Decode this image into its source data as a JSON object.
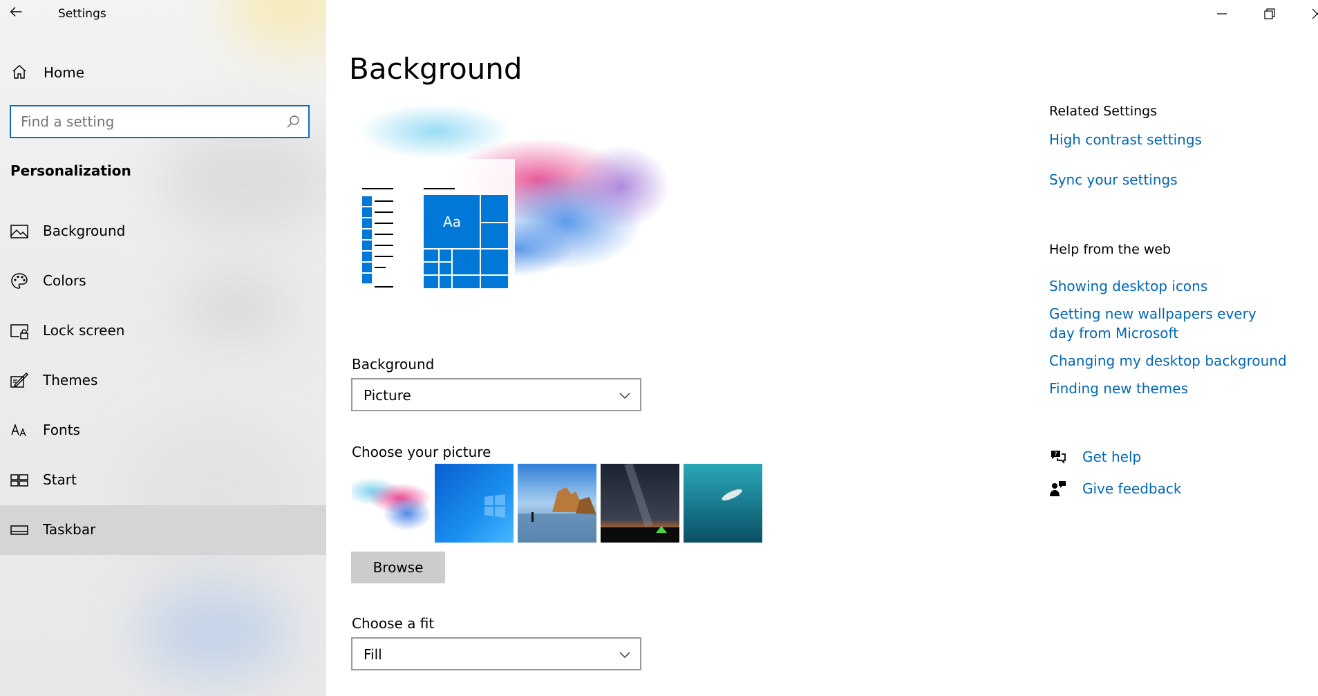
{
  "window": {
    "title": "Settings",
    "controls": {
      "minimize": "minimize-icon",
      "restore": "restore-icon",
      "close": "close-icon"
    }
  },
  "sidebar": {
    "home_label": "Home",
    "search": {
      "placeholder": "Find a setting",
      "value": ""
    },
    "section_title": "Personalization",
    "items": [
      {
        "label": "Background",
        "icon": "picture-icon",
        "selected": false
      },
      {
        "label": "Colors",
        "icon": "palette-icon",
        "selected": false
      },
      {
        "label": "Lock screen",
        "icon": "lock-screen-icon",
        "selected": false
      },
      {
        "label": "Themes",
        "icon": "themes-icon",
        "selected": false
      },
      {
        "label": "Fonts",
        "icon": "fonts-icon",
        "selected": false
      },
      {
        "label": "Start",
        "icon": "start-icon",
        "selected": false
      },
      {
        "label": "Taskbar",
        "icon": "taskbar-icon",
        "selected": true
      }
    ]
  },
  "main": {
    "page_title": "Background",
    "preview_tile_text": "Aa",
    "background_label": "Background",
    "background_value": "Picture",
    "choose_picture_label": "Choose your picture",
    "browse_label": "Browse",
    "fit_label": "Choose a fit",
    "fit_value": "Fill"
  },
  "related": {
    "related_heading": "Related Settings",
    "related_links": [
      "High contrast settings",
      "Sync your settings"
    ],
    "web_heading": "Help from the web",
    "web_links": [
      "Showing desktop icons",
      "Getting new wallpapers every day from Microsoft",
      "Changing my desktop background",
      "Finding new themes"
    ],
    "get_help": "Get help",
    "give_feedback": "Give feedback"
  },
  "colors": {
    "accent": "#0078d7",
    "link": "#0066b4",
    "selected_nav": "#d5d5d5"
  }
}
